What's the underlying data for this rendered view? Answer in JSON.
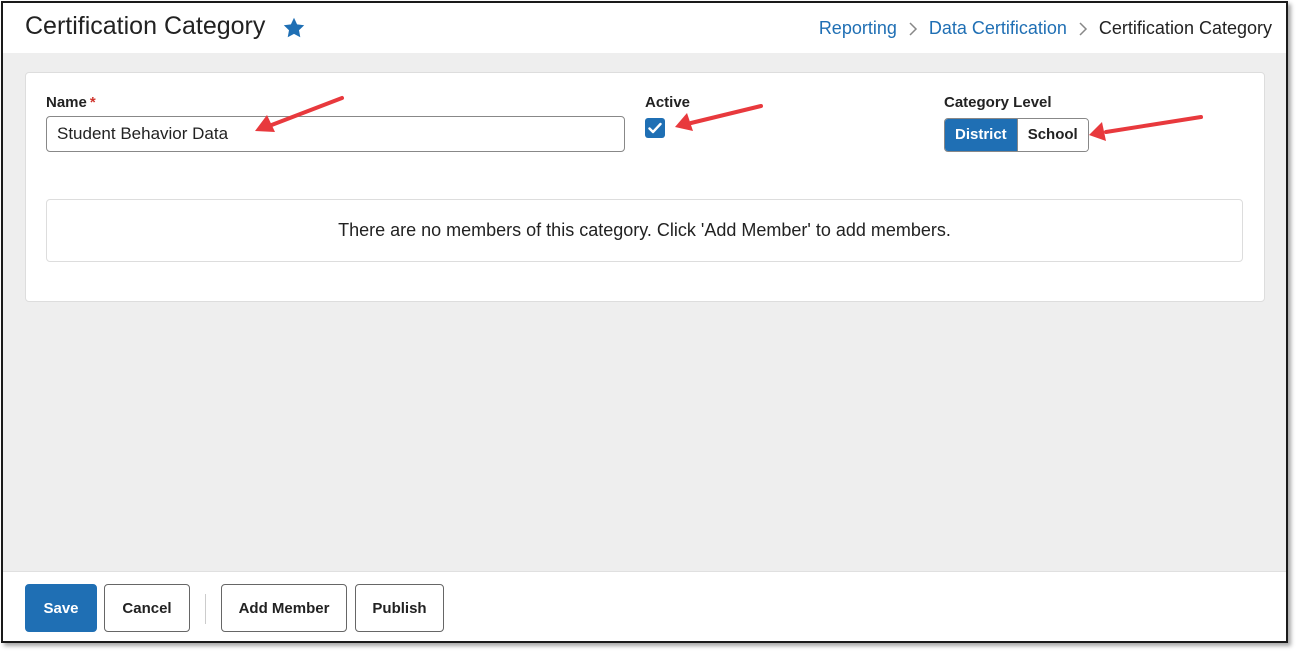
{
  "header": {
    "title": "Certification Category",
    "favorite_icon": "star-icon",
    "breadcrumb": {
      "items": [
        "Reporting",
        "Data Certification"
      ],
      "current": "Certification Category",
      "separator_icon": "chevron-right-icon"
    }
  },
  "form": {
    "name": {
      "label": "Name",
      "required_marker": "*",
      "value": "Student Behavior Data"
    },
    "active": {
      "label": "Active",
      "checked": true
    },
    "category_level": {
      "label": "Category Level",
      "options": [
        "District",
        "School"
      ],
      "selected": "District"
    }
  },
  "members": {
    "empty_message": "There are no members of this category. Click 'Add Member' to add members."
  },
  "footer": {
    "save_label": "Save",
    "cancel_label": "Cancel",
    "add_member_label": "Add Member",
    "publish_label": "Publish"
  },
  "colors": {
    "primary": "#1f6fb4",
    "required": "#d0342c",
    "annotation_arrow": "#e8393d",
    "background": "#eeeeee"
  }
}
